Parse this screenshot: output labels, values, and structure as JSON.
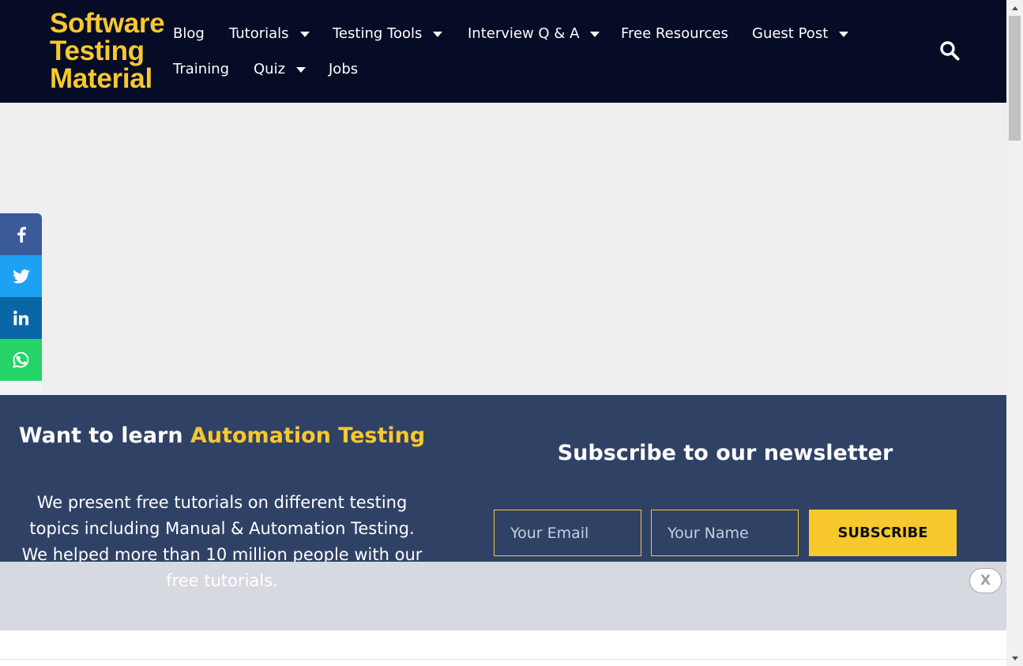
{
  "brand": {
    "line1": "Software",
    "line2": "Testing",
    "line3": "Material",
    "color": "#f8c82e"
  },
  "nav": {
    "items": [
      {
        "label": "Blog",
        "has_dropdown": false
      },
      {
        "label": "Tutorials",
        "has_dropdown": true
      },
      {
        "label": "Testing Tools",
        "has_dropdown": true
      },
      {
        "label": "Interview Q & A",
        "has_dropdown": true
      },
      {
        "label": "Free Resources",
        "has_dropdown": false
      },
      {
        "label": "Guest Post",
        "has_dropdown": true
      },
      {
        "label": "Training",
        "has_dropdown": false
      },
      {
        "label": "Quiz",
        "has_dropdown": true
      },
      {
        "label": "Jobs",
        "has_dropdown": false
      }
    ],
    "search_icon": "search-icon"
  },
  "social": {
    "buttons": [
      {
        "icon": "facebook-icon",
        "color": "#3b5a9a"
      },
      {
        "icon": "twitter-icon",
        "color": "#1da1f2"
      },
      {
        "icon": "linkedin-icon",
        "color": "#0a66a6"
      },
      {
        "icon": "whatsapp-icon",
        "color": "#25d366"
      },
      {
        "icon": "plus-icon",
        "label": "+"
      }
    ]
  },
  "promo": {
    "title_prefix": "Want to learn ",
    "title_highlight": "Automation Testing",
    "text_visible": "We present free tutorials on different testing topics including Manual & Automation Testing. We helped more than 10 million people with our",
    "text_continued": "free tutorials."
  },
  "newsletter": {
    "title": "Subscribe to our newsletter",
    "email_placeholder": "Your Email",
    "name_placeholder": "Your Name",
    "button_label": "SUBSCRIBE"
  },
  "overlay": {
    "close_label": "X"
  },
  "colors": {
    "header_bg": "#060b26",
    "promo_bg": "#2f4266",
    "accent": "#f8c82e",
    "ad_bg": "#efefef",
    "overlay_bg": "#d6d9df"
  }
}
